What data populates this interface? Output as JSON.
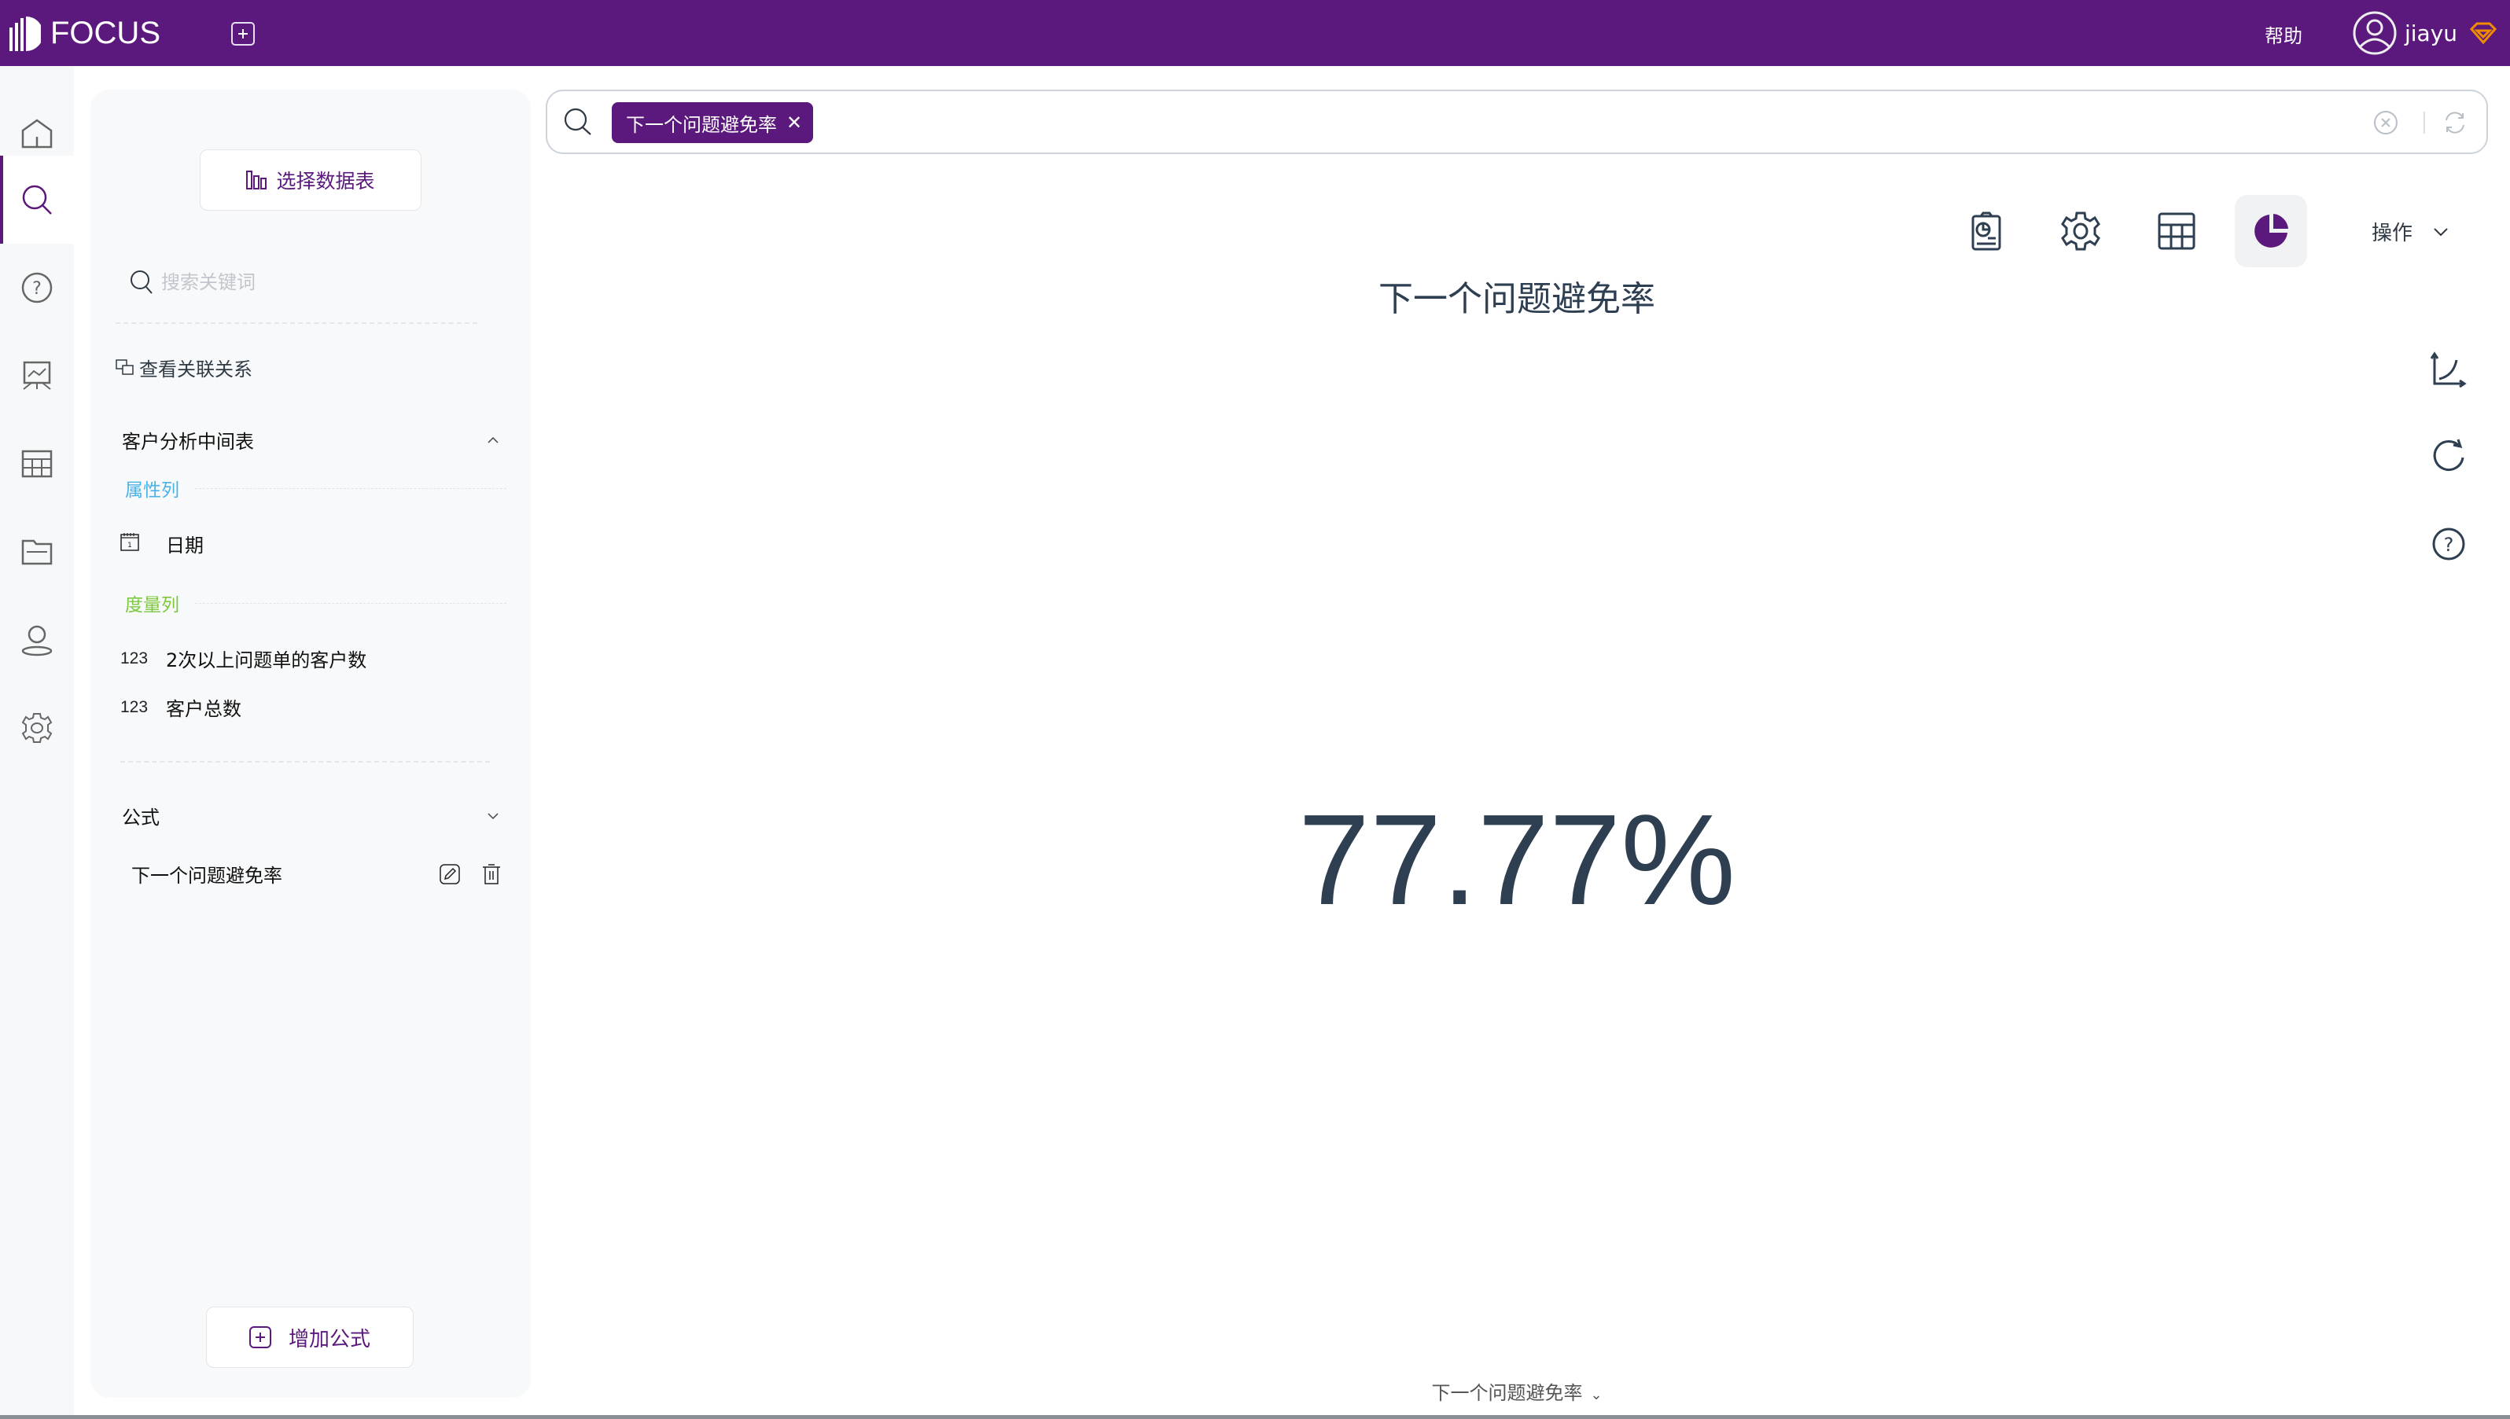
{
  "header": {
    "brand": "FOCUS",
    "help_label": "帮助",
    "username": "jiayu",
    "new_tab_icon": "plus-square-icon",
    "user_icon": "user-circle-icon",
    "vip_icon": "diamond-icon",
    "vip_color": "#f08c00"
  },
  "colors": {
    "brand": "#5c197d",
    "attribute_label": "#4ab2e5",
    "measure_label": "#7cc93e",
    "text_dark": "#2f3f52"
  },
  "rail": {
    "items": [
      {
        "name": "home",
        "icon": "home-icon",
        "active": false
      },
      {
        "name": "search",
        "icon": "search-icon",
        "active": true
      },
      {
        "name": "question",
        "icon": "question-circle-icon",
        "active": false
      },
      {
        "name": "presentation",
        "icon": "presentation-board-icon",
        "active": false
      },
      {
        "name": "table",
        "icon": "table-icon",
        "active": false
      },
      {
        "name": "folder",
        "icon": "folder-icon",
        "active": false
      },
      {
        "name": "user",
        "icon": "user-icon",
        "active": false
      },
      {
        "name": "settings",
        "icon": "gear-icon",
        "active": false
      }
    ]
  },
  "panel": {
    "select_table_label": "选择数据表",
    "keyword_placeholder": "搜索关键词",
    "relation_label": "查看关联关系",
    "table_group": {
      "name": "客户分析中间表",
      "attribute_label": "属性列",
      "attributes": [
        {
          "type_icon": "calendar-icon",
          "name": "日期"
        }
      ],
      "measure_label": "度量列",
      "measures": [
        {
          "type_label": "123",
          "name": "2次以上问题单的客户数"
        },
        {
          "type_label": "123",
          "name": "客户总数"
        }
      ]
    },
    "formula_group": {
      "name": "公式",
      "items": [
        {
          "name": "下一个问题避免率"
        }
      ]
    },
    "add_formula_label": "增加公式"
  },
  "search": {
    "tokens": [
      {
        "label": "下一个问题避免率"
      }
    ],
    "placeholder": ""
  },
  "toolbar": {
    "buttons": [
      {
        "name": "report",
        "icon": "clipboard-chart-icon"
      },
      {
        "name": "settings",
        "icon": "gear-icon"
      },
      {
        "name": "table",
        "icon": "table-icon"
      },
      {
        "name": "chart-type",
        "icon": "pie-chart-icon",
        "active": true
      }
    ],
    "operations_label": "操作"
  },
  "side_tools": [
    {
      "name": "axis",
      "icon": "axis-chart-icon"
    },
    {
      "name": "refresh",
      "icon": "refresh-icon"
    },
    {
      "name": "help",
      "icon": "question-circle-icon"
    }
  ],
  "result": {
    "title": "下一个问题避免率",
    "value": "77.77%",
    "axis_selector_label": "下一个问题避免率"
  }
}
